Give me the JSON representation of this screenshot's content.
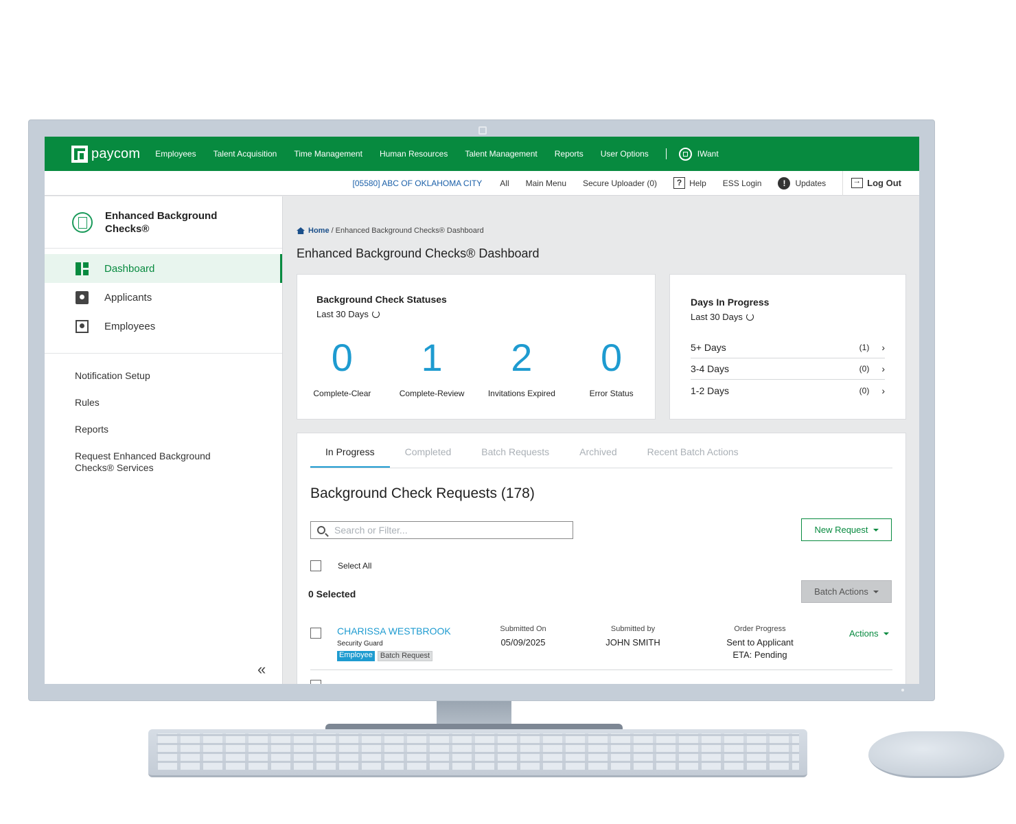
{
  "topnav": {
    "logo": "paycom",
    "items": [
      "Employees",
      "Talent Acquisition",
      "Time Management",
      "Human Resources",
      "Talent Management",
      "Reports",
      "User Options"
    ],
    "iwant": "IWant"
  },
  "subbar": {
    "company": "[05580] ABC OF OKLAHOMA CITY",
    "all": "All",
    "main_menu": "Main Menu",
    "secure_uploader": "Secure Uploader (0)",
    "help": "Help",
    "ess_login": "ESS Login",
    "updates": "Updates",
    "logout": "Log Out"
  },
  "sidebar": {
    "title": "Enhanced Background Checks®",
    "nav": [
      {
        "label": "Dashboard",
        "icon": "dashboard-icon"
      },
      {
        "label": "Applicants",
        "icon": "clipboard-user-icon"
      },
      {
        "label": "Employees",
        "icon": "employee-card-icon"
      }
    ],
    "links": [
      "Notification Setup",
      "Rules",
      "Reports",
      "Request Enhanced Background Checks® Services"
    ],
    "collapse": "«"
  },
  "breadcrumb": {
    "home": "Home",
    "current": "/ Enhanced Background Checks® Dashboard"
  },
  "page_title": "Enhanced Background Checks® Dashboard",
  "statuses": {
    "title": "Background Check Statuses",
    "period": "Last 30 Days",
    "items": [
      {
        "value": "0",
        "label": "Complete-Clear"
      },
      {
        "value": "1",
        "label": "Complete-Review"
      },
      {
        "value": "2",
        "label": "Invitations Expired"
      },
      {
        "value": "0",
        "label": "Error Status"
      }
    ]
  },
  "days": {
    "title": "Days In Progress",
    "period": "Last 30 Days",
    "rows": [
      {
        "label": "5+ Days",
        "count": "(1)"
      },
      {
        "label": "3-4 Days",
        "count": "(0)"
      },
      {
        "label": "1-2 Days",
        "count": "(0)"
      }
    ]
  },
  "requests": {
    "tabs": [
      "In Progress",
      "Completed",
      "Batch Requests",
      "Archived",
      "Recent Batch Actions"
    ],
    "title": "Background Check Requests (178)",
    "search_placeholder": "Search or Filter...",
    "new_request": "New Request",
    "select_all": "Select All",
    "selected": "0 Selected",
    "batch_actions": "Batch Actions",
    "rows": [
      {
        "name": "CHARISSA WESTBROOK",
        "job": "Security Guard",
        "badges": [
          "Employee",
          "Batch Request"
        ],
        "submitted_on_label": "Submitted On",
        "submitted_on": "05/09/2025",
        "submitted_by_label": "Submitted by",
        "submitted_by": "JOHN SMITH",
        "progress_label": "Order Progress",
        "progress": "Sent to Applicant",
        "eta": "ETA: Pending",
        "actions": "Actions"
      }
    ]
  },
  "colors": {
    "brand_green": "#078a3f",
    "accent_blue": "#1e9bd0",
    "link_blue": "#1a5fa8"
  }
}
